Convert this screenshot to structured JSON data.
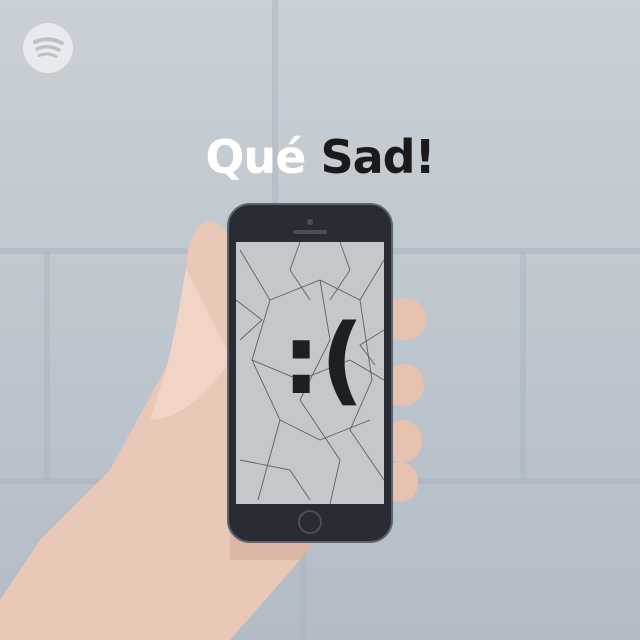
{
  "brand": {
    "logo_icon": "spotify-logo-icon"
  },
  "title": {
    "word1": "Qué",
    "word2": "Sad!"
  },
  "screen": {
    "emoticon": ":("
  },
  "colors": {
    "title_light": "#ffffff",
    "title_dark": "#1a1a1a",
    "wall": "#bfc7cf"
  }
}
